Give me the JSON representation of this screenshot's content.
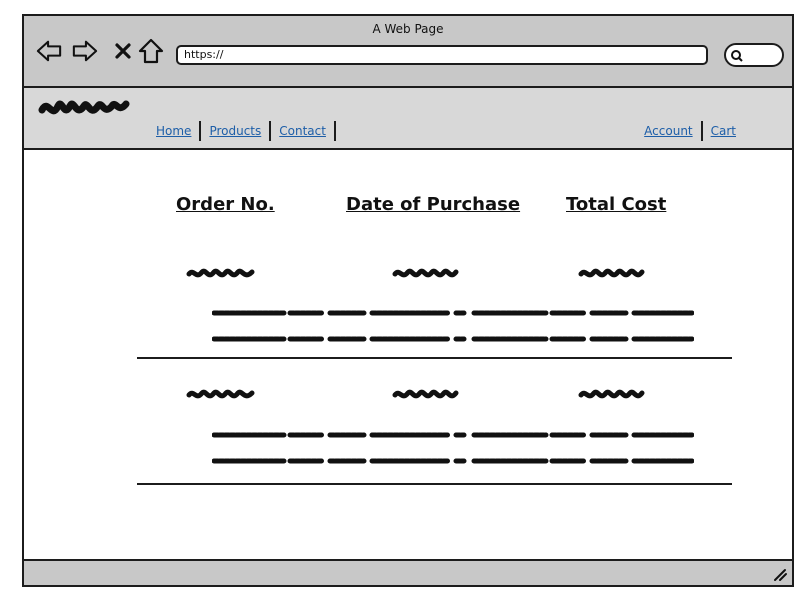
{
  "window": {
    "title": "A Web Page"
  },
  "browser": {
    "url": "https://",
    "icons": [
      "back-arrow-icon",
      "forward-arrow-icon",
      "close-x-icon",
      "home-icon",
      "search-icon"
    ]
  },
  "site": {
    "nav_left": [
      "Home",
      "Products",
      "Contact"
    ],
    "nav_right": [
      "Account",
      "Cart"
    ],
    "nav_link_color": "#1d5ea8"
  },
  "table": {
    "headers": [
      "Order No.",
      "Date of Purchase",
      "Total Cost"
    ]
  },
  "colors": {
    "chrome": "#c8c8c8",
    "header": "#d8d8d8",
    "outline": "#1c1c1c"
  }
}
